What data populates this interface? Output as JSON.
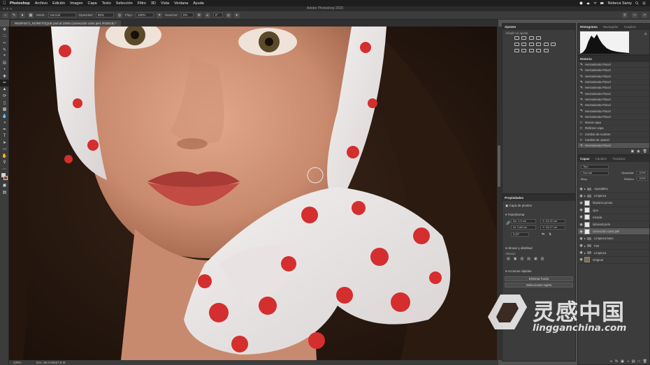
{
  "menubar": {
    "items": [
      "Photoshop",
      "Archivo",
      "Edición",
      "Imagen",
      "Capa",
      "Texto",
      "Selección",
      "Filtro",
      "3D",
      "Vista",
      "Ventana",
      "Ayuda"
    ],
    "user": "Rebeca Sarsy"
  },
  "window": {
    "title": "Adobe Photoshop 2020"
  },
  "options": {
    "mode_label": "Modo:",
    "mode_value": "Normal",
    "opacity_label": "Opacidad:",
    "opacity_value": "80%",
    "flow_label": "Flujo:",
    "flow_value": "100%",
    "smooth_label": "Suavizar:",
    "smooth_value": "0%",
    "angle_value": "0°"
  },
  "document": {
    "tab": "RNSP3471_NORETOQUE.psd al 100% (corrección color piel, RGB/16) *",
    "zoom": "100%",
    "doc_info": "Doc: 69,0 M/637,6 M"
  },
  "adjustments": {
    "tab": "Ajustes",
    "hint": "Añadir un ajuste"
  },
  "histogram_panel": {
    "tabs": [
      "Histograma",
      "Navegador",
      "Cuadros"
    ]
  },
  "history": {
    "tab": "Historia",
    "items": [
      "Herramienta Pincel",
      "Herramienta Pincel",
      "Herramienta Pincel",
      "Herramienta Pincel",
      "Herramienta Pincel",
      "Herramienta Pincel",
      "Herramienta Pincel",
      "Herramienta Pincel",
      "Herramienta Pincel",
      "Herramienta Pincel",
      "Nueva capa",
      "Rellenar capa",
      "Cambio de nombre",
      "Cambio de opacid",
      "Herramienta Pincel"
    ]
  },
  "properties": {
    "tab": "Propiedades",
    "layer_type": "Capa de píxeles",
    "transform_label": "Transformar",
    "w": "An: 1,9 cm",
    "h": "Al: 1,68 cm",
    "x": "X: 24,22 cm",
    "y": "Y: 18,17 cm",
    "angle": "0,00°",
    "align_label": "Alinear y distribuir",
    "align_sub": "Alinear:",
    "quick_label": "Acciones rápidas",
    "btn_remove_bg": "Eliminar fondo",
    "btn_select_subject": "Seleccionar sujeto"
  },
  "layers": {
    "tabs": [
      "Capas",
      "Canales",
      "Trazados"
    ],
    "kind": "Tipo",
    "blend": "Normal",
    "opacity_label": "Opacidad:",
    "opacity": "100%",
    "lock_label": "Bloq.:",
    "fill_label": "Relleno:",
    "fill": "100%",
    "items": [
      {
        "name": "Ajustables",
        "type": "group"
      },
      {
        "name": "Limpieza",
        "type": "group"
      },
      {
        "name": "limpieza pecas",
        "type": "layer"
      },
      {
        "name": "ojos",
        "type": "layer"
      },
      {
        "name": "mirada",
        "type": "layer"
      },
      {
        "name": "labiosalt pelo",
        "type": "layer"
      },
      {
        "name": "corrección color piel",
        "type": "layer",
        "selected": true
      },
      {
        "name": "Limpieza base",
        "type": "group"
      },
      {
        "name": "Piel",
        "type": "group"
      },
      {
        "name": "Limpieza",
        "type": "group"
      },
      {
        "name": "Original",
        "type": "layer"
      }
    ]
  },
  "watermark": {
    "cn": "灵感中国",
    "url": "lingganchina.com"
  },
  "colors": {
    "accent": "#1a73e8",
    "panel": "#3c3c3c",
    "dark": "#2a2a2a"
  }
}
